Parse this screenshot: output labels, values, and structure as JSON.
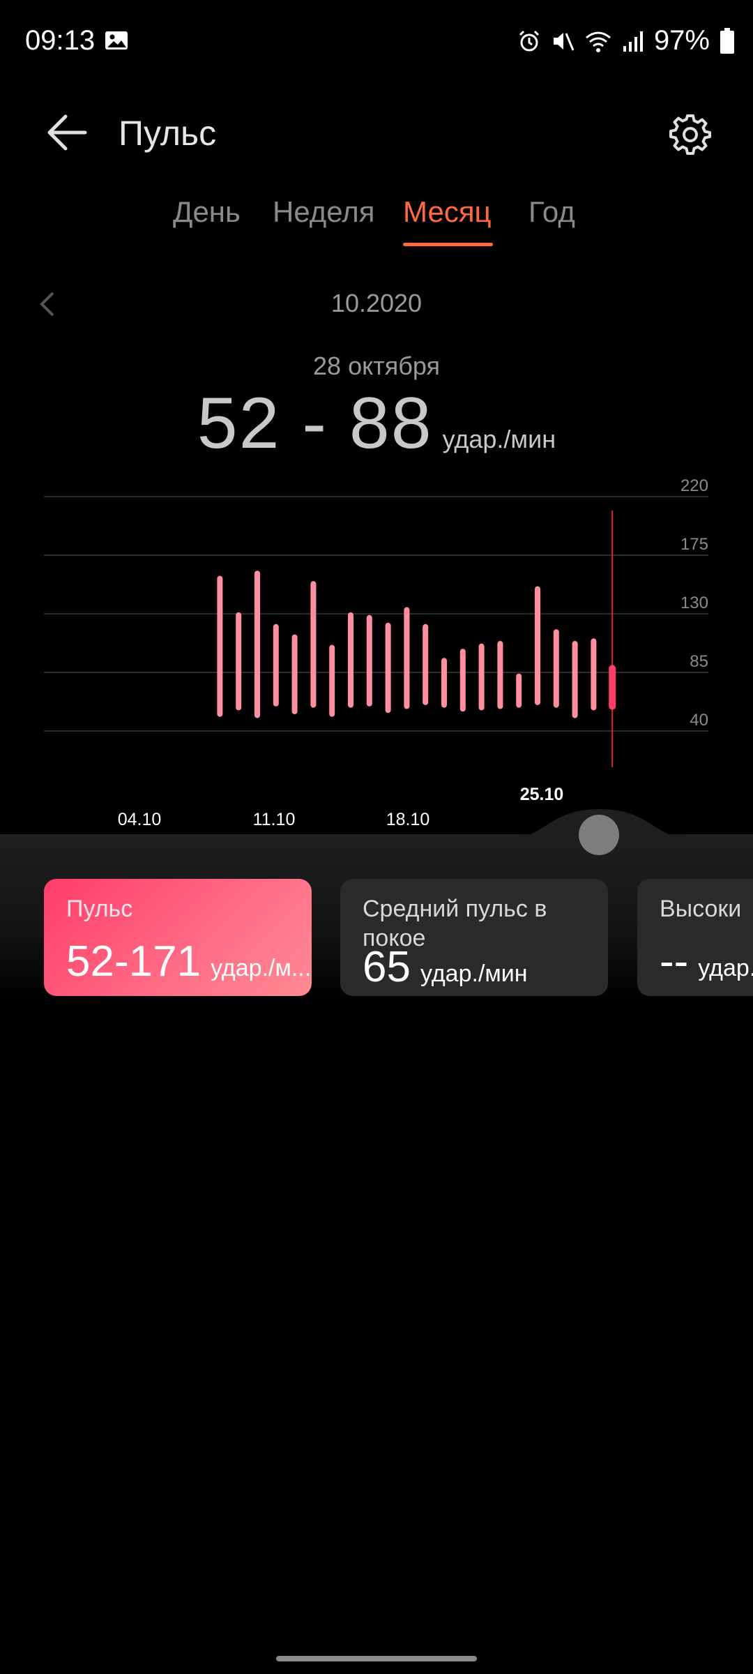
{
  "status_bar": {
    "time": "09:13",
    "battery": "97%",
    "icons": [
      "gallery-icon",
      "alarm-icon",
      "mute-icon",
      "wifi-icon",
      "signal-icon",
      "battery-icon"
    ]
  },
  "header": {
    "title": "Пульс",
    "back_icon": "arrow-left-icon",
    "settings_icon": "gear-icon"
  },
  "tabs": [
    {
      "label": "День",
      "active": false
    },
    {
      "label": "Неделя",
      "active": false
    },
    {
      "label": "Месяц",
      "active": true
    },
    {
      "label": "Год",
      "active": false
    }
  ],
  "period": {
    "label": "10.2020",
    "prev_icon": "chevron-left-icon"
  },
  "selection": {
    "date": "28 октября",
    "range": "52 - 88",
    "unit": "удар./мин"
  },
  "colors": {
    "accent": "#ff6a3d",
    "bar": "#ff8fa0",
    "bar_selected": "#ff3d66",
    "cursor": "#e0213a"
  },
  "chart_data": {
    "type": "bar",
    "chart_kind": "range-bar",
    "y_ticks": [
      "220",
      "175",
      "130",
      "85",
      "40"
    ],
    "ylim": [
      40,
      220
    ],
    "x_tick_labels": [
      "04.10",
      "11.10",
      "18.10",
      "25.10"
    ],
    "highlighted_x_label": "25.10",
    "categories": [
      "01.10",
      "02.10",
      "03.10",
      "04.10",
      "05.10",
      "06.10",
      "07.10",
      "08.10",
      "09.10",
      "10.10",
      "11.10",
      "12.10",
      "13.10",
      "14.10",
      "15.10",
      "16.10",
      "17.10",
      "18.10",
      "19.10",
      "20.10",
      "21.10",
      "22.10",
      "23.10",
      "24.10",
      "25.10",
      "26.10",
      "27.10",
      "28.10"
    ],
    "series": [
      {
        "low": [
          null,
          null,
          null,
          null,
          null,
          null,
          null,
          null,
          53,
          58,
          52,
          61,
          55,
          60,
          53,
          60,
          61,
          56,
          59,
          62,
          60,
          57,
          58,
          59,
          60,
          62,
          60,
          52,
          58,
          59,
          55,
          52
        ],
        "high": [
          null,
          null,
          null,
          null,
          null,
          null,
          null,
          null,
          157,
          129,
          161,
          120,
          112,
          153,
          104,
          129,
          127,
          121,
          133,
          120,
          94,
          101,
          105,
          107,
          82,
          149,
          116,
          107,
          109,
          88
        ]
      }
    ],
    "selected_index": 29,
    "grid": true
  },
  "cards": [
    {
      "title": "Пульс",
      "value": "52-171",
      "unit": "удар./м..."
    },
    {
      "title": "Средний пульс в покое",
      "value": "65",
      "unit": "удар./мин"
    },
    {
      "title": "Высоки",
      "value": "--",
      "unit": "удар."
    }
  ]
}
